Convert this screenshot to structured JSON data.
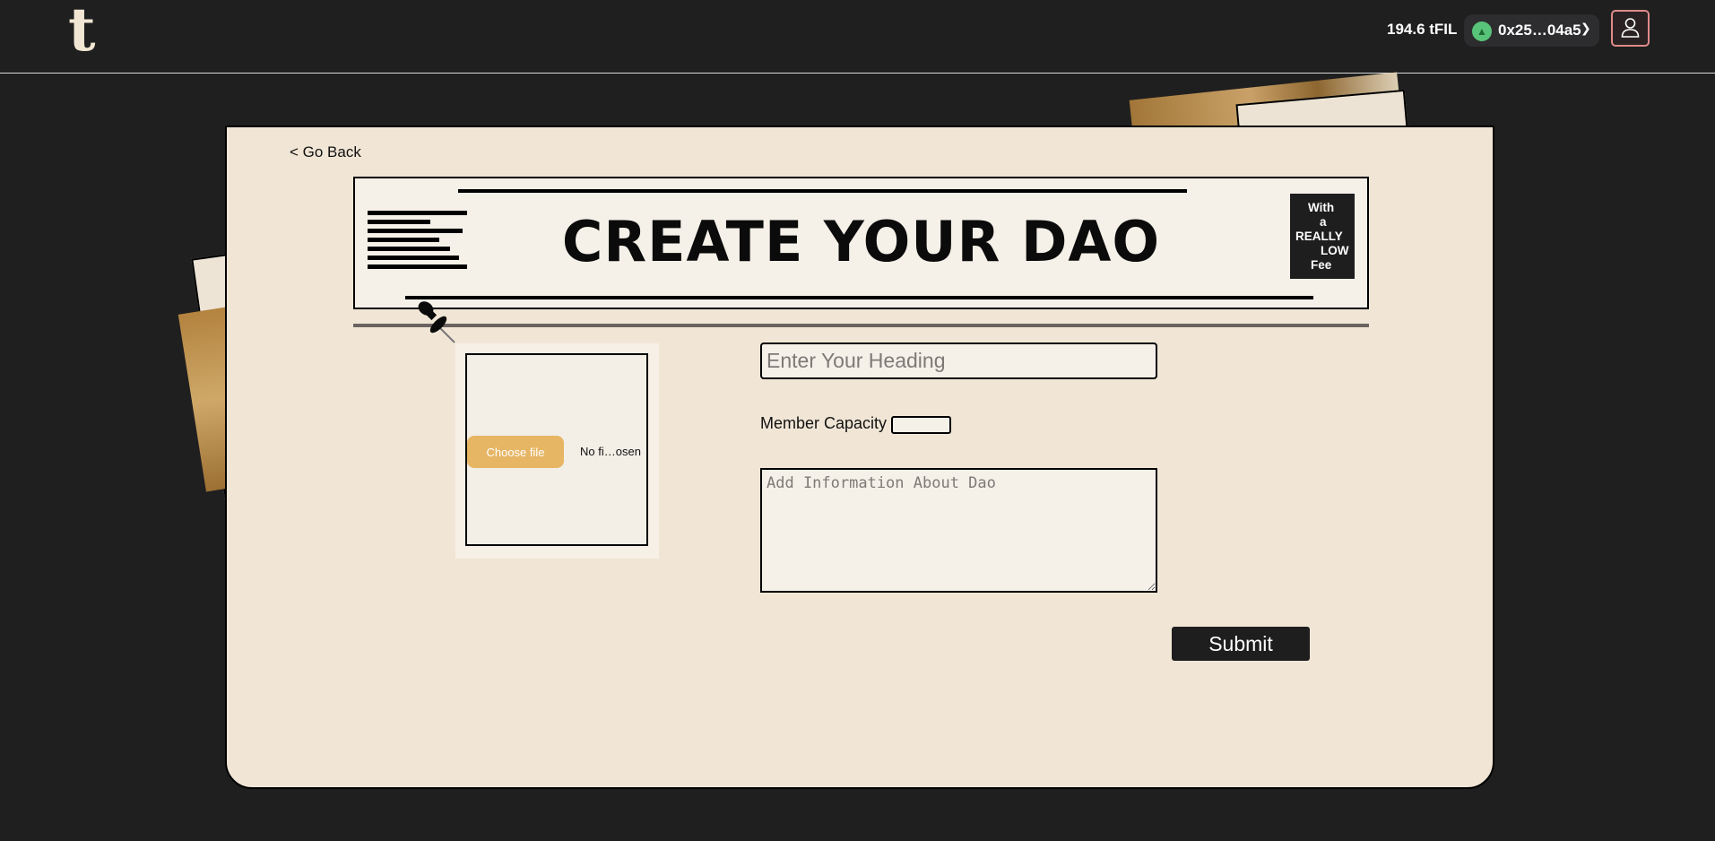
{
  "header": {
    "logo_text": "t",
    "balance": "194.6 tFIL",
    "account_address": "0x25…04a5",
    "avatar_icon": "tree-avatar-icon",
    "chevron": "chevron-down-icon",
    "profile_icon": "user-profile-icon"
  },
  "card": {
    "back_label": "< Go Back",
    "banner_title": "CREATE YOUR DAO",
    "fee_box": [
      "With",
      "a",
      "REALLY",
      "LOW",
      "Fee"
    ],
    "upload": {
      "choose_label": "Choose file",
      "status": "No fi…osen"
    },
    "heading_placeholder": "Enter Your Heading",
    "member_capacity_label": "Member Capacity",
    "info_placeholder": "Add Information About Dao",
    "submit_label": "Submit"
  },
  "colors": {
    "background": "#1f1f1f",
    "card": "#f1e6d6",
    "accent_button": "#e6b665",
    "profile_border": "#e08a8a",
    "avatar": "#58c47a"
  }
}
